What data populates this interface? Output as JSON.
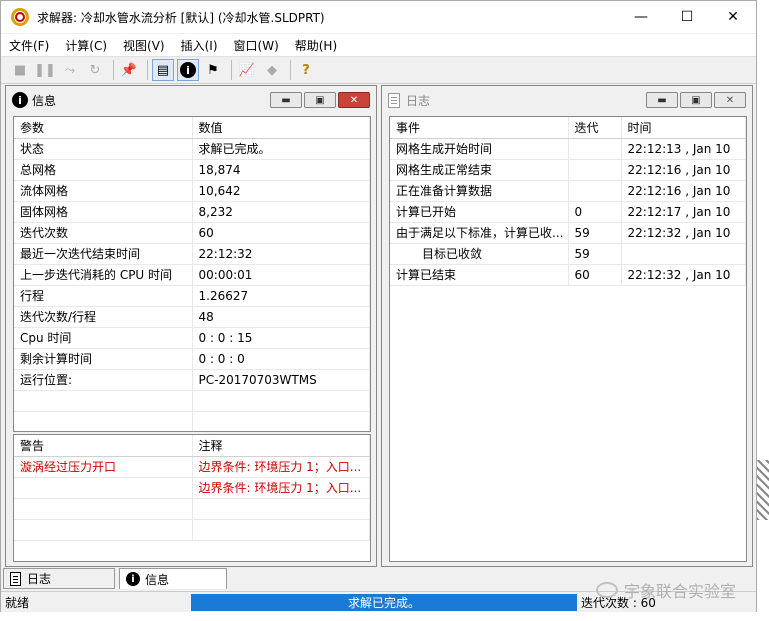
{
  "window": {
    "title": "求解器: 冷却水管水流分析 [默认] (冷却水管.SLDPRT)",
    "controls": {
      "minimize": "—",
      "maximize": "☐",
      "close": "✕"
    }
  },
  "menu": [
    "文件(F)",
    "计算(C)",
    "视图(V)",
    "插入(I)",
    "窗口(W)",
    "帮助(H)"
  ],
  "toolbar": {
    "icons": [
      "stop-icon",
      "pause-icon",
      "step-icon",
      "refresh-icon",
      "pin-icon",
      "log-icon",
      "info-icon",
      "goal-flag-icon",
      "plot-icon",
      "preview-icon",
      "help-icon"
    ]
  },
  "info_panel": {
    "title": "信息",
    "columns": [
      "参数",
      "数值"
    ],
    "rows": [
      [
        "状态",
        "求解已完成。"
      ],
      [
        "总网格",
        "18,874"
      ],
      [
        "流体网格",
        "10,642"
      ],
      [
        "固体网格",
        "8,232"
      ],
      [
        "迭代次数",
        "60"
      ],
      [
        "最近一次迭代结束时间",
        "22:12:32"
      ],
      [
        "上一步迭代消耗的 CPU 时间",
        "00:00:01"
      ],
      [
        "行程",
        "1.26627"
      ],
      [
        "迭代次数/行程",
        "48"
      ],
      [
        "Cpu 时间",
        "0 : 0 : 15"
      ],
      [
        "剩余计算时间",
        "0 : 0 : 0"
      ],
      [
        "运行位置:",
        "PC-20170703WTMS"
      ]
    ],
    "warnings_columns": [
      "警告",
      "注释"
    ],
    "warnings": [
      [
        "漩涡经过压力开口",
        "边界条件: 环境压力 1；入口..."
      ],
      [
        "",
        "边界条件: 环境压力 1；入口..."
      ]
    ]
  },
  "log_panel": {
    "title": "日志",
    "columns": [
      "事件",
      "迭代",
      "时间"
    ],
    "rows": [
      [
        "网格生成开始时间",
        "",
        "22:12:13 , Jan 10"
      ],
      [
        "网格生成正常结束",
        "",
        "22:12:16 , Jan 10"
      ],
      [
        "正在准备计算数据",
        "",
        "22:12:16 , Jan 10"
      ],
      [
        "计算已开始",
        "0",
        "22:12:17 , Jan 10"
      ],
      [
        "由于满足以下标准，计算已收...",
        "59",
        "22:12:32 , Jan 10"
      ],
      [
        "　目标已收敛",
        "59",
        ""
      ],
      [
        "计算已结束",
        "60",
        "22:12:32 , Jan 10"
      ]
    ]
  },
  "tabs": [
    "日志",
    "信息"
  ],
  "status": {
    "left": "就绪",
    "progress_text": "求解已完成。",
    "right": "迭代次数 : 60"
  },
  "watermark": "宇象联合实验室"
}
